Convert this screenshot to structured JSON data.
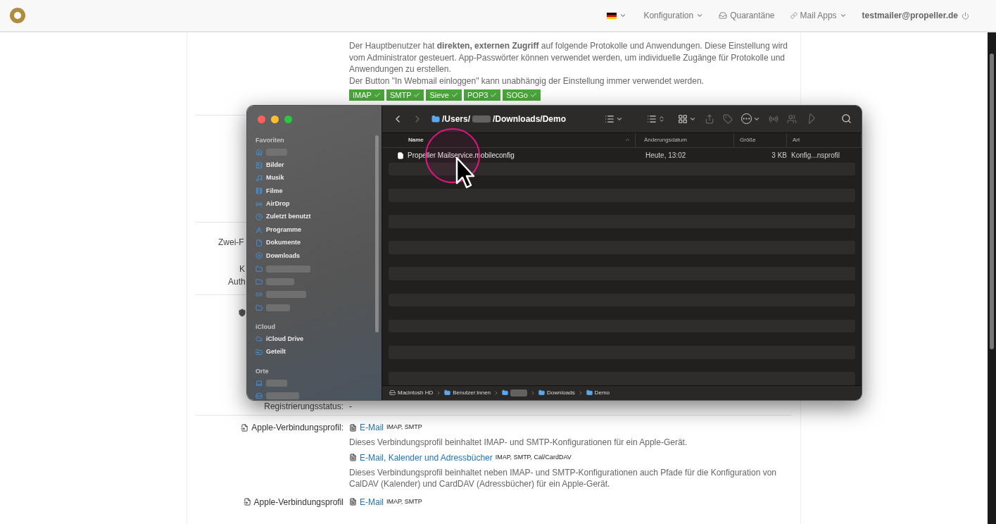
{
  "navbar": {
    "items": [
      {
        "kind": "flag",
        "dropdown": true
      },
      {
        "kind": "link",
        "label": "Konfiguration",
        "dropdown": true
      },
      {
        "kind": "quarantine",
        "label": "Quarantäne",
        "dropdown": false
      },
      {
        "kind": "apps",
        "label": "Mail Apps",
        "dropdown": true
      },
      {
        "kind": "user",
        "label": "testmailer@propeller.de",
        "dropdown": false
      }
    ]
  },
  "access": {
    "paragraphs": [
      "Der Hauptbenutzer hat **direkten, externen Zugriff** auf folgende Protokolle und Anwendungen. Diese Einstellung wird vom Administrator gesteuert. App-Passwörter können verwendet werden, um individuelle Zugänge für Protokolle und Anwendungen zu erstellen.",
      "Der Button \"In Webmail einloggen\" kann unabhängig der Einstellung immer verwendet werden."
    ],
    "protocols": [
      {
        "label": "IMAP",
        "enabled": true
      },
      {
        "label": "SMTP",
        "enabled": true
      },
      {
        "label": "Sieve",
        "enabled": true
      },
      {
        "label": "POP3",
        "enabled": true
      },
      {
        "label": "SOGo",
        "enabled": true
      }
    ]
  },
  "covered_labels": [
    "Zwei-F",
    "K",
    "Auth"
  ],
  "registration": {
    "label": "Registrierungsstatus:",
    "value": "-"
  },
  "profiles": [
    {
      "label": "Apple-Verbindungsprofil:",
      "links": [
        {
          "title": "E-Mail",
          "protocols": "IMAP, SMTP",
          "description": "Dieses Verbindungsprofil beinhaltet IMAP- und SMTP-Konfigurationen für ein Apple-Gerät."
        },
        {
          "title": "E-Mail, Kalender und Adressbücher",
          "protocols": "IMAP, SMTP, Cal/CardDAV",
          "description": "Dieses Verbindungsprofil beinhaltet neben IMAP- und SMTP-Konfigurationen auch Pfade für die Konfiguration von CalDAV (Kalender) und CardDAV (Adressbücher) für ein Apple-Gerät."
        }
      ]
    },
    {
      "label": "Apple-Verbindungsprofil",
      "links": [
        {
          "title": "E-Mail",
          "protocols": "IMAP, SMTP"
        }
      ]
    }
  ],
  "finder": {
    "path_start": "/Users/",
    "path_end": "/Downloads/Demo",
    "sidebar": [
      {
        "title": "Favoriten",
        "items": [
          {
            "redacted": true
          },
          {
            "label": "Bilder",
            "redacted": false
          },
          {
            "label": "Musik",
            "redacted": false
          },
          {
            "label": "Filme",
            "redacted": false
          },
          {
            "label": "AirDrop",
            "redacted": false
          },
          {
            "label": "Zuletzt benutzt",
            "redacted": false
          },
          {
            "label": "Programme",
            "redacted": false
          },
          {
            "label": "Dokumente",
            "redacted": false
          },
          {
            "label": "Downloads",
            "redacted": false
          },
          {
            "redacted": true
          },
          {
            "redacted": true
          },
          {
            "redacted": true
          },
          {
            "redacted": true
          }
        ]
      },
      {
        "title": "iCloud",
        "items": [
          {
            "label": "iCloud Drive",
            "redacted": false
          },
          {
            "label": "Geteilt",
            "redacted": false
          }
        ]
      },
      {
        "title": "Orte",
        "items": [
          {
            "redacted": true
          },
          {
            "redacted": true
          }
        ]
      }
    ],
    "columns": [
      {
        "label": "Name",
        "sorted": true
      },
      {
        "label": "Änderungsdatum",
        "sorted": false
      },
      {
        "label": "Größe",
        "sorted": false
      },
      {
        "label": "Art",
        "sorted": false
      }
    ],
    "files": [
      {
        "name": "Propeller Mailservice.mobileconfig",
        "modified": "Heute, 13:02",
        "size": "3 KB",
        "kind": "Konfig...nsprofil"
      }
    ],
    "pathbar": [
      {
        "label": "Macintosh HD",
        "redacted": false
      },
      {
        "label": "Benutzer:innen",
        "redacted": false
      },
      {
        "redacted": true
      },
      {
        "label": "Downloads",
        "redacted": false
      },
      {
        "label": "Demo",
        "redacted": false
      }
    ]
  }
}
